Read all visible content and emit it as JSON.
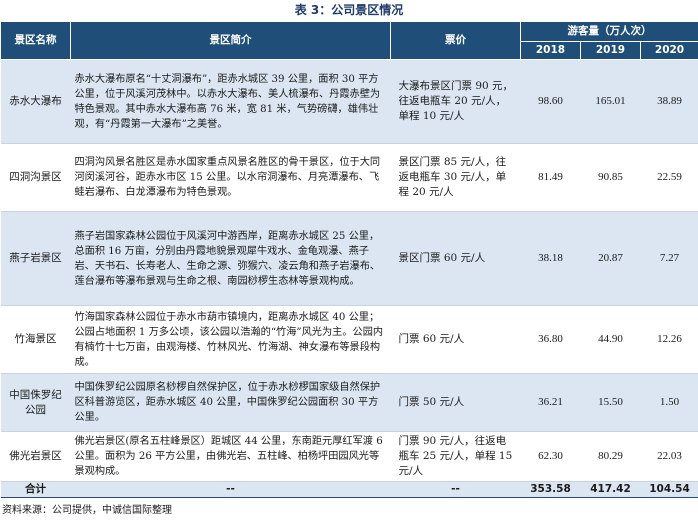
{
  "title": "表 3：公司景区情况",
  "headers": {
    "name": "景区名称",
    "intro": "景区简介",
    "ticket": "票价",
    "visitors": "游客量（万人次）",
    "years": [
      "2018",
      "2019",
      "2020"
    ]
  },
  "rows": [
    {
      "name": "赤水大瀑布",
      "intro": "赤水大瀑布原名“十丈洞瀑布”，距赤水城区 39 公里，面积 30 平方公里，位于风溪河茂林中。以赤水大瀑布、美人梳瀑布、丹霞赤壁为特色景观。其中赤水大瀑布高 76 米，宽 81 米，气势磅礴，雄伟壮观，有“丹霞第一大瀑布”之美誉。",
      "ticket": "大瀑布景区门票 90 元，往返电瓶车 20 元/人，单程 10 元/人",
      "v2018": "98.60",
      "v2019": "165.01",
      "v2020": "38.89"
    },
    {
      "name": "四洞沟景区",
      "intro": "四洞沟风景名胜区是赤水国家重点风景名胜区的骨干景区，位于大同河闵溪河谷，距赤水市区 15 公里。以水帘洞瀑布、月亮潭瀑布、飞蛙岩瀑布、白龙潭瀑布为特色景观。",
      "ticket": "景区门票 85 元/人，往返电瓶车 30 元/人，单程 20 元/人",
      "v2018": "81.49",
      "v2019": "90.85",
      "v2020": "22.59"
    },
    {
      "name": "燕子岩景区",
      "intro": "燕子岩国家森林公园位于风溪河中游西岸，距离赤水城区 25 公里，总面积 16 万亩，分别由丹霞地貌景观犀牛戏水、金龟观瀑、燕子岩、天书石、长寿老人、生命之源、弥猴穴、凌云角和燕子岩瀑布、莲台瀑布等瀑布景观与生命之根、南园桫椤生态林等景观构成。",
      "ticket": "景区门票 60 元/人",
      "v2018": "38.18",
      "v2019": "20.87",
      "v2020": "7.27"
    },
    {
      "name": "竹海景区",
      "intro": "竹海国家森林公园位于赤水市葫市镇境内，距离赤水城区 40 公里；公园占地面积 1 万多公顷，该公园以浩瀚的“竹海”风光为主。公园内有楠竹十七万亩，由观海楼、竹林风光、竹海湖、神女瀑布等景段构成。",
      "ticket": "门票 60 元/人",
      "v2018": "36.80",
      "v2019": "44.90",
      "v2020": "12.26"
    },
    {
      "name": "中国侏罗纪公园",
      "intro": "中国侏罗纪公园原名桫椤自然保护区，位于赤水桫椤国家级自然保护区科普游览区，距赤水城区 40 公里，中国侏罗纪公园面积 30 平方公里。",
      "ticket": "门票 50 元/人",
      "v2018": "36.21",
      "v2019": "15.50",
      "v2020": "1.50"
    },
    {
      "name": "佛光岩景区",
      "intro": "佛光岩景区(原名五柱峰景区）距城区 44 公里，东南距元厚红军渡 6 公里。面积为 26 平方公里，由佛光岩、五柱峰、柏杨坪田园风光等景观构成。",
      "ticket": "门票 90 元/人，往返电瓶车 25 元/人，单程 15 元/人",
      "v2018": "62.30",
      "v2019": "80.29",
      "v2020": "22.03"
    }
  ],
  "total": {
    "label": "合计",
    "intro": "--",
    "ticket": "--",
    "v2018": "353.58",
    "v2019": "417.42",
    "v2020": "104.54"
  },
  "source": "资料来源：公司提供，中诚信国际整理",
  "colors": {
    "header_bg": "#1f4e79",
    "alt_row_bg": "#dce6f2",
    "title": "#1f3c6b"
  }
}
